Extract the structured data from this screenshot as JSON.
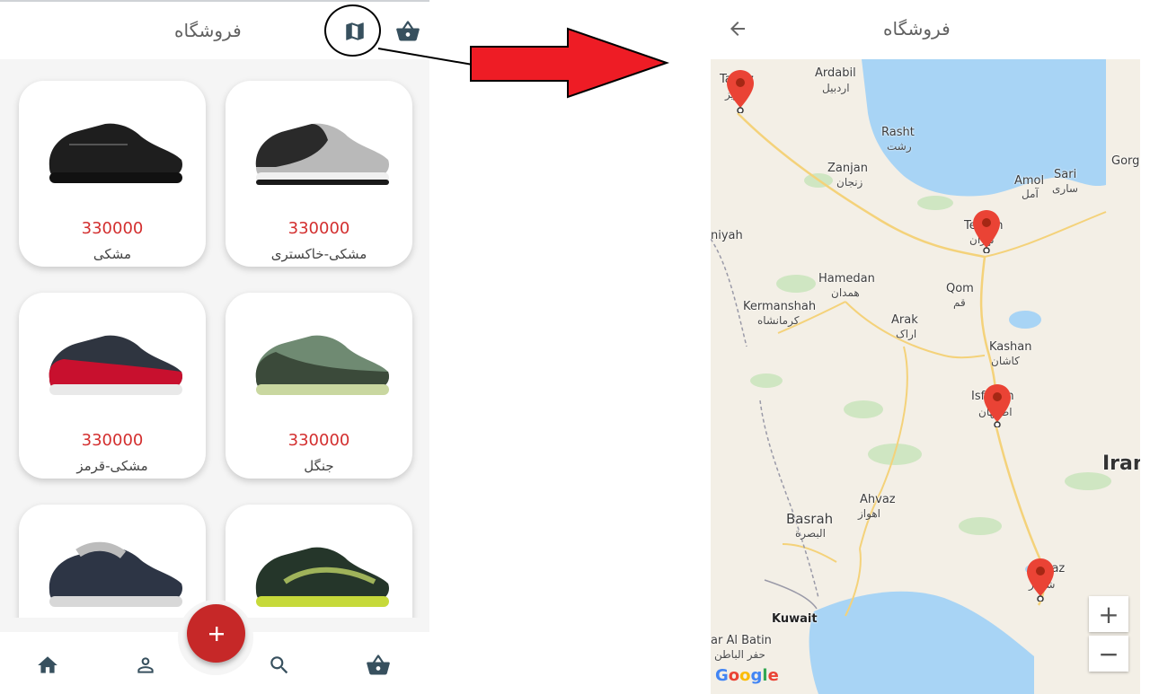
{
  "left_screen": {
    "title": "فروشگاه",
    "products": [
      {
        "price": "330000",
        "name": "مشکی-خاکستری",
        "shoe_color": "#2a2a2a",
        "accent": "#b9b9b9",
        "sole": "#f0f0f0"
      },
      {
        "price": "330000",
        "name": "مشکی",
        "shoe_color": "#1e1e1e",
        "accent": "#2a2a2a",
        "sole": "#111111"
      },
      {
        "price": "330000",
        "name": "جنگل",
        "shoe_color": "#3b4a3a",
        "accent": "#6f8a72",
        "sole": "#c9d7a0"
      },
      {
        "price": "330000",
        "name": "مشکی-قرمز",
        "shoe_color": "#c8102e",
        "accent": "#2f3540",
        "sole": "#e9e9e9"
      },
      {
        "price": "",
        "name": "",
        "shoe_color": "#25362a",
        "accent": "#9fb35a",
        "sole": "#c6d93a"
      },
      {
        "price": "",
        "name": "",
        "shoe_color": "#2d3545",
        "accent": "#bcbcbc",
        "sole": "#d8d8d8"
      }
    ],
    "icons": {
      "map": "map-icon",
      "basket": "basket-icon",
      "add": "plus-icon"
    },
    "nav": [
      "home-icon",
      "person-icon",
      "search-icon",
      "basket-icon"
    ],
    "colors": {
      "accent": "#c62828",
      "price": "#d32f2f",
      "nav_icon": "#37505e"
    }
  },
  "right_screen": {
    "title": "فروشگاه",
    "map": {
      "cities": [
        {
          "en": "Ardabil",
          "fa": "اردبیل"
        },
        {
          "en": "Rasht",
          "fa": "رشت"
        },
        {
          "en": "Zanjan",
          "fa": "زنجان"
        },
        {
          "en": "Amol",
          "fa": "آمل"
        },
        {
          "en": "Sari",
          "fa": "ساری"
        },
        {
          "en": "Gorga",
          "fa": ""
        },
        {
          "en": "Hamedan",
          "fa": "همدان"
        },
        {
          "en": "Kermanshah",
          "fa": "کرمانشاه"
        },
        {
          "en": "Qom",
          "fa": "قم"
        },
        {
          "en": "Arak",
          "fa": "اراک"
        },
        {
          "en": "Kashan",
          "fa": "کاشان"
        },
        {
          "en": "Ahvaz",
          "fa": "اهواز"
        },
        {
          "en": "Basrah",
          "fa": "البصرة"
        },
        {
          "en": "Kuwait",
          "fa": ""
        },
        {
          "en": "ar Al Batin",
          "fa": "حفر الباطن"
        },
        {
          "en": "niyah",
          "fa": ""
        },
        {
          "en": "Tehran",
          "fa": "تهران"
        },
        {
          "en": "Isfahan",
          "fa": "اصفهان"
        },
        {
          "en": "Shiraz",
          "fa": "شیراز"
        },
        {
          "en": "Tabriz",
          "fa": "تبریز"
        }
      ],
      "country_label": "Iran",
      "attribution": "Google",
      "zoom_in": "+",
      "zoom_out": "−"
    }
  }
}
